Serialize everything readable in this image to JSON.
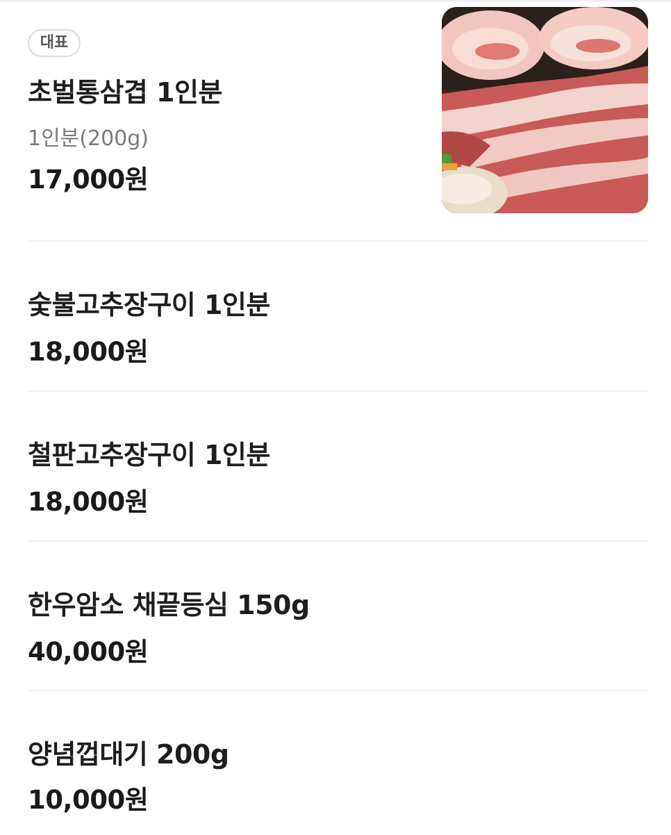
{
  "menu": {
    "items": [
      {
        "badge": "대표",
        "name": "초벌통삼겹 1인분",
        "description": "1인분(200g)",
        "price": "17,000원",
        "image_icon": "pork-belly-photo"
      },
      {
        "name": "숯불고추장구이 1인분",
        "price": "18,000원"
      },
      {
        "name": "철판고추장구이 1인분",
        "price": "18,000원"
      },
      {
        "name": "한우암소 채끝등심 150g",
        "price": "40,000원"
      },
      {
        "name": "양념껍대기 200g",
        "price": "10,000원"
      }
    ]
  },
  "colors": {
    "divider": "#ececec",
    "price": "#1a1a1a",
    "description": "#7a7a7a",
    "badge_border": "#dadada"
  }
}
